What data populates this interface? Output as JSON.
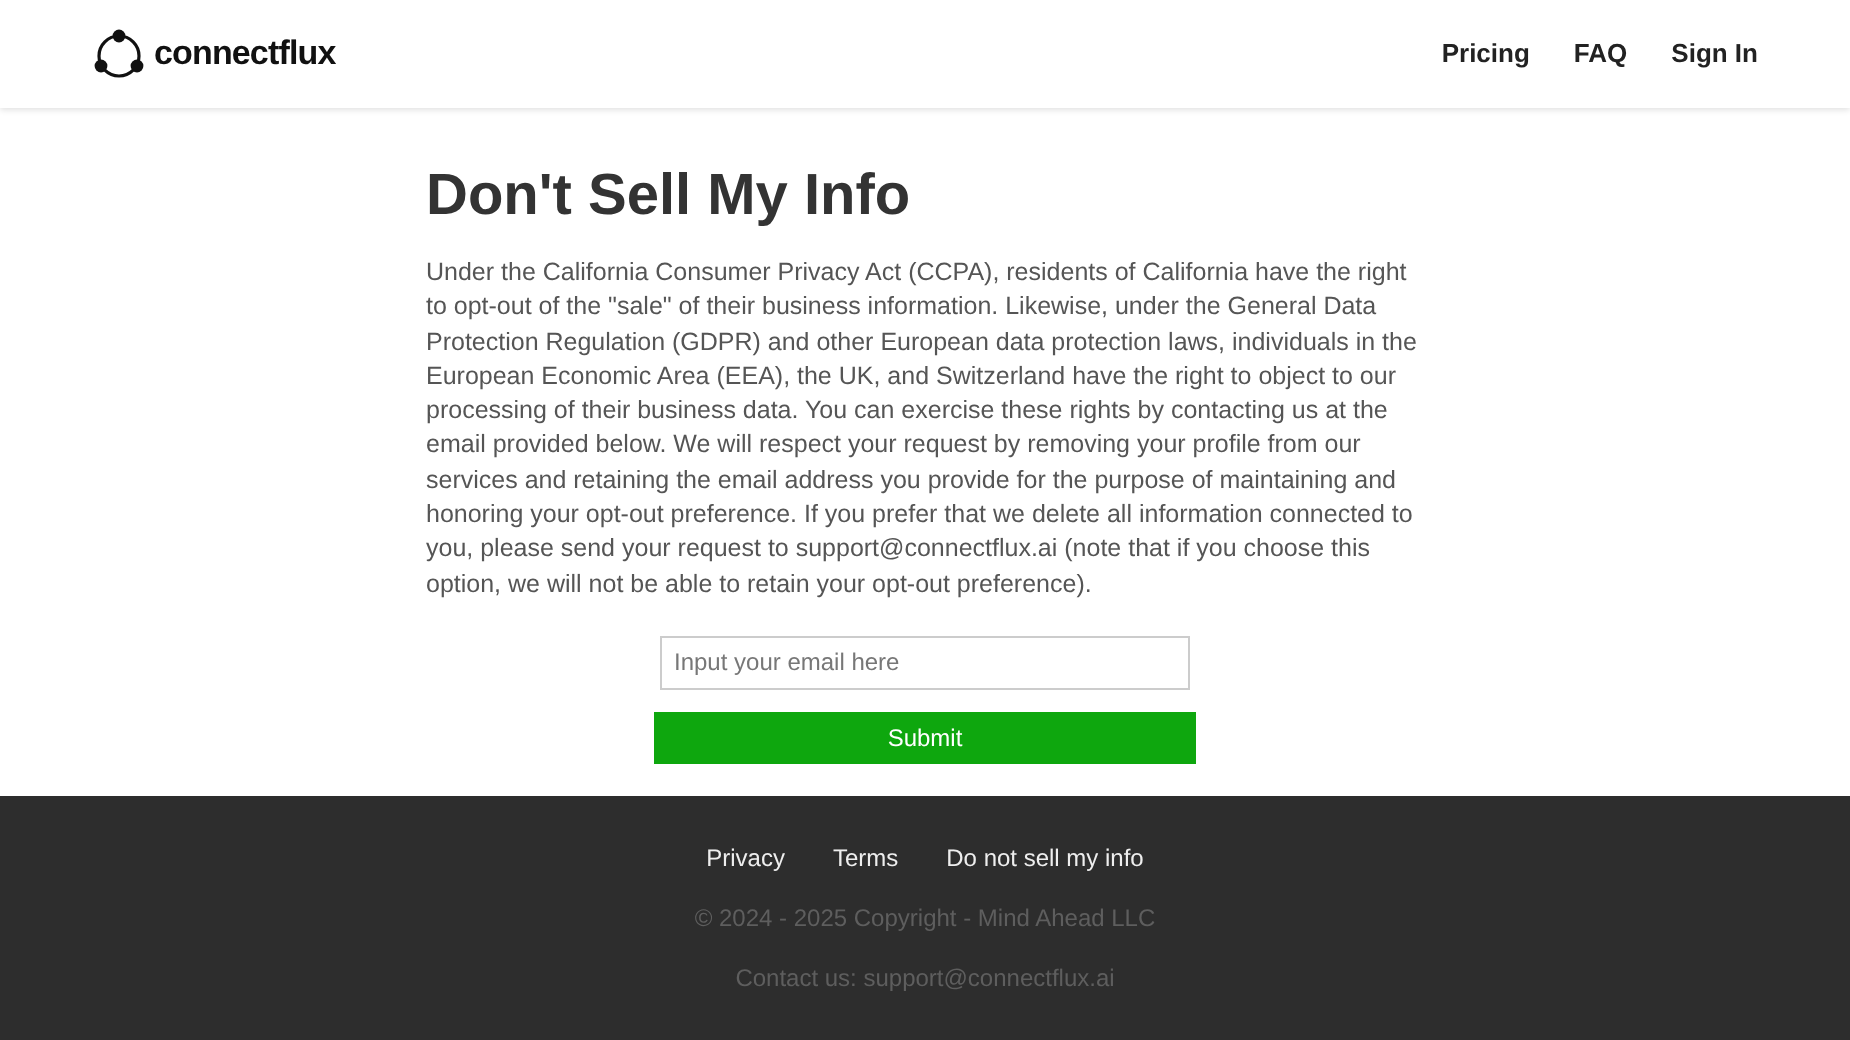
{
  "header": {
    "logo": "connectflux",
    "nav": [
      "Pricing",
      "FAQ",
      "Sign In"
    ]
  },
  "main": {
    "title": "Don't Sell My Info",
    "body": "Under the California Consumer Privacy Act (CCPA), residents of California have the right to opt-out of the \"sale\" of their business information. Likewise, under the General Data Protection Regulation (GDPR) and other European data protection laws, individuals in the European Economic Area (EEA), the UK, and Switzerland have the right to object to our processing of their business data. You can exercise these rights by contacting us at the email provided below. We will respect your request by removing your profile from our services and retaining the email address you provide for the purpose of maintaining and honoring your opt-out preference. If you prefer that we delete all information connected to you, please send your request to support@connectflux.ai (note that if you choose this option, we will not be able to retain your opt-out preference).",
    "email": {
      "placeholder": "Input your email here"
    },
    "submit": "Submit"
  },
  "footer": {
    "links": [
      "Privacy",
      "Terms",
      "Do not sell my info"
    ],
    "copyright": "© 2024 - 2025 Copyright - Mind Ahead LLC",
    "contact": "Contact us: support@connectflux.ai"
  }
}
